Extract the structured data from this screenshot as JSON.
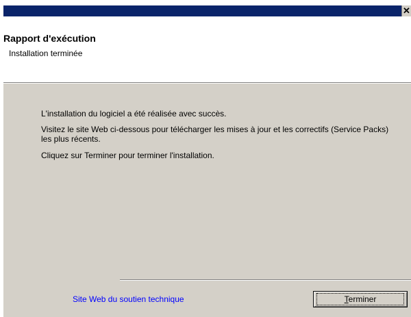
{
  "dialog": {
    "title": "Rapport d'exécution",
    "subtitle": "Installation terminée",
    "close_symbol": "✕",
    "messages": [
      "L'installation du logiciel a été réalisée avec succès.",
      "Visitez le site Web ci-dessous pour télécharger les mises à jour et les correctifs (Service Packs) les plus récents.",
      "Cliquez sur Terminer pour terminer l'installation."
    ],
    "support_link": "Site Web du soutien technique",
    "finish_button": {
      "mnemonic": "T",
      "rest": "erminer"
    }
  },
  "colors": {
    "titlebar": "#0a246a",
    "dialog_bg": "#d4d0c8",
    "link": "#0000ff"
  }
}
